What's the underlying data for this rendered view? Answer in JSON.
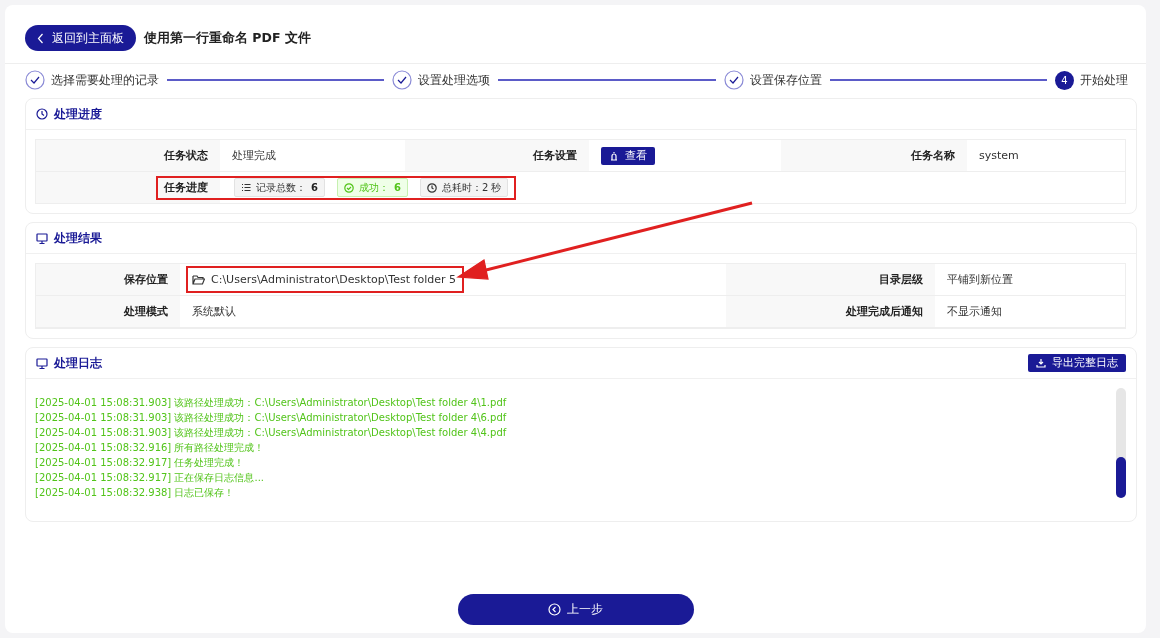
{
  "header": {
    "back_button": "返回到主面板",
    "title": "使用第一行重命名 PDF 文件"
  },
  "steps": [
    {
      "label": "选择需要处理的记录",
      "done": true
    },
    {
      "label": "设置处理选项",
      "done": true
    },
    {
      "label": "设置保存位置",
      "done": true
    },
    {
      "label": "开始处理",
      "done": false,
      "number": "4"
    }
  ],
  "progress_section": {
    "title": "处理进度",
    "status_label": "任务状态",
    "status_value": "处理完成",
    "settings_label": "任务设置",
    "settings_button": "查看",
    "name_label": "任务名称",
    "name_value": "system",
    "progress_label": "任务进度",
    "highlighted": true,
    "tags": [
      {
        "kind": "total",
        "label": "记录总数：",
        "value": "6"
      },
      {
        "kind": "success",
        "label": "成功：",
        "value": "6"
      },
      {
        "kind": "time",
        "label": "总耗时：2 秒"
      }
    ]
  },
  "result_section": {
    "title": "处理结果",
    "save_label": "保存位置",
    "save_value": "C:\\Users\\Administrator\\Desktop\\Test folder 5",
    "highlighted": true,
    "level_label": "目录层级",
    "level_value": "平铺到新位置",
    "mode_label": "处理模式",
    "mode_value": "系统默认",
    "notify_label": "处理完成后通知",
    "notify_value": "不显示通知"
  },
  "callout_arrow": true,
  "log_section": {
    "title": "处理日志",
    "export_button": "导出完整日志",
    "lines": [
      "[2025-04-01 15:08:31.903] 该路径处理成功：C:\\Users\\Administrator\\Desktop\\Test folder 4\\1.pdf",
      "[2025-04-01 15:08:31.903] 该路径处理成功：C:\\Users\\Administrator\\Desktop\\Test folder 4\\6.pdf",
      "[2025-04-01 15:08:31.903] 该路径处理成功：C:\\Users\\Administrator\\Desktop\\Test folder 4\\4.pdf",
      "[2025-04-01 15:08:32.916] 所有路径处理完成！",
      "[2025-04-01 15:08:32.917] 任务处理完成！",
      "[2025-04-01 15:08:32.917] 正在保存日志信息...",
      "[2025-04-01 15:08:32.938] 日志已保存！"
    ]
  },
  "footer": {
    "prev_button": "上一步"
  }
}
